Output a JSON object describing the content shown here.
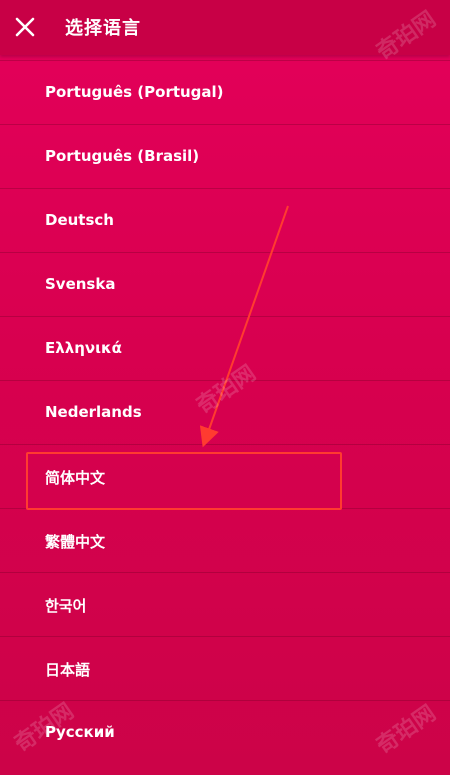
{
  "header": {
    "title": "选择语言",
    "close_icon": "close-icon"
  },
  "languages": [
    {
      "label": "Português (Portugal)"
    },
    {
      "label": "Português (Brasil)"
    },
    {
      "label": "Deutsch"
    },
    {
      "label": "Svenska"
    },
    {
      "label": "Ελληνικά"
    },
    {
      "label": "Nederlands"
    },
    {
      "label": "简体中文",
      "highlighted": true
    },
    {
      "label": "繁體中文"
    },
    {
      "label": "한국어"
    },
    {
      "label": "日本語"
    },
    {
      "label": "Русский"
    }
  ],
  "annotation": {
    "highlight_color": "#ff3b30",
    "arrow_color": "#ff3b30"
  },
  "watermark": {
    "text": "奇珀网"
  },
  "colors": {
    "background": "#dc0052",
    "header": "#c80046",
    "text": "#ffffff"
  }
}
